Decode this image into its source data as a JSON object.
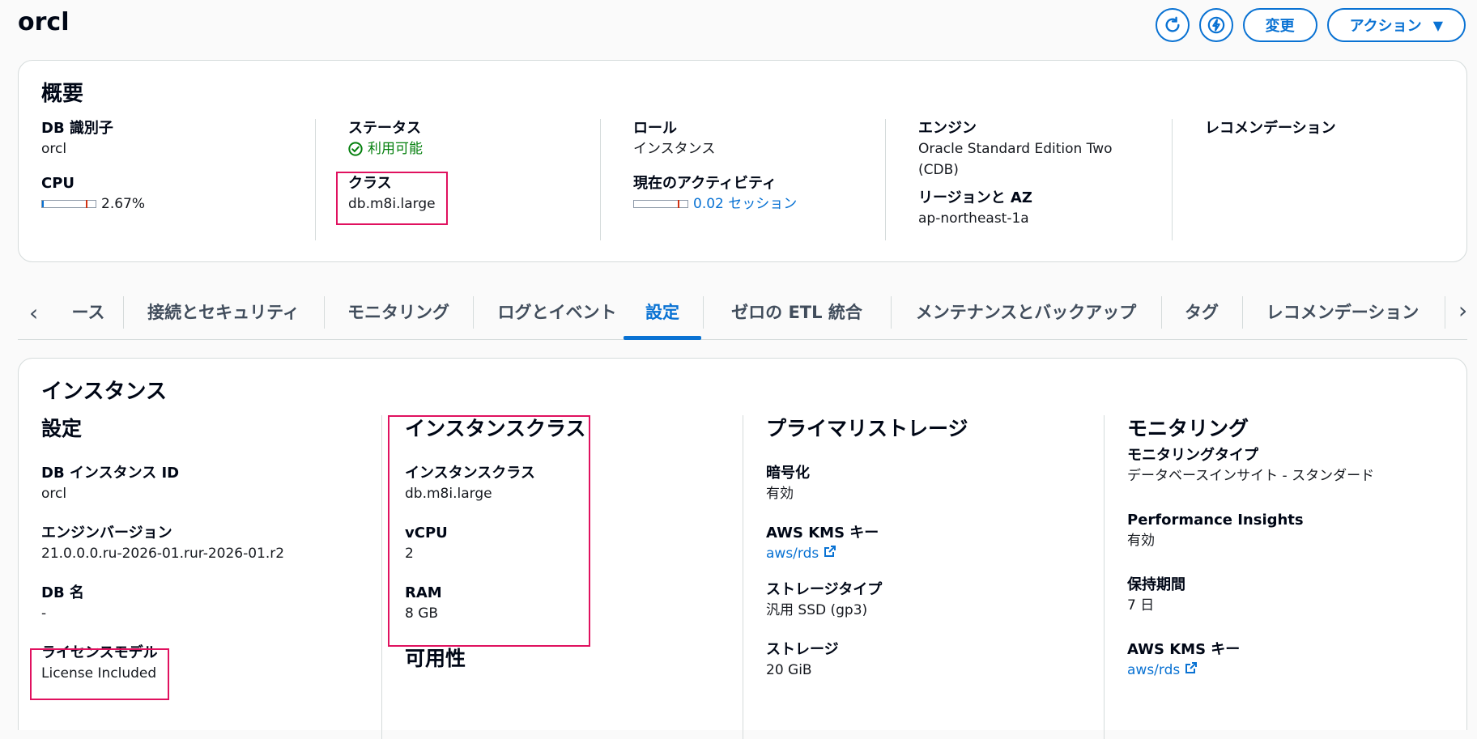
{
  "header": {
    "title": "orcl",
    "modify_label": "変更",
    "actions_label": "アクション"
  },
  "summary": {
    "title": "概要",
    "db_id_label": "DB 識別子",
    "db_id_value": "orcl",
    "cpu_label": "CPU",
    "cpu_value": "2.67%",
    "cpu_fraction": 0.0267,
    "status_label": "ステータス",
    "status_value": "利用可能",
    "class_label": "クラス",
    "class_value": "db.m8i.large",
    "role_label": "ロール",
    "role_value": "インスタンス",
    "activity_label": "現在のアクティビティ",
    "activity_value": "0.02 セッション",
    "engine_label": "エンジン",
    "engine_value_line1": "Oracle Standard Edition Two",
    "engine_value_line2": "(CDB)",
    "region_label": "リージョンと AZ",
    "region_value": "ap-northeast-1a",
    "recommendation_label": "レコメンデーション"
  },
  "tabs": [
    {
      "label": "ース"
    },
    {
      "label": "接続とセキュリティ"
    },
    {
      "label": "モニタリング"
    },
    {
      "label": "ログとイベント"
    },
    {
      "label": "設定"
    },
    {
      "label": "ゼロの ETL 統合"
    },
    {
      "label": "メンテナンスとバックアップ"
    },
    {
      "label": "タグ"
    },
    {
      "label": "レコメンデーション"
    }
  ],
  "instance": {
    "title": "インスタンス",
    "config": {
      "title": "設定",
      "instance_id_label": "DB インスタンス ID",
      "instance_id_value": "orcl",
      "engine_version_label": "エンジンバージョン",
      "engine_version_value": "21.0.0.0.ru-2026-01.rur-2026-01.r2",
      "db_name_label": "DB 名",
      "db_name_value": "-",
      "license_label": "ライセンスモデル",
      "license_value": "License Included"
    },
    "instance_class": {
      "title": "インスタンスクラス",
      "class_label": "インスタンスクラス",
      "class_value": "db.m8i.large",
      "vcpu_label": "vCPU",
      "vcpu_value": "2",
      "ram_label": "RAM",
      "ram_value": "8 GB",
      "availability_title": "可用性"
    },
    "storage": {
      "title": "プライマリストレージ",
      "encryption_label": "暗号化",
      "encryption_value": "有効",
      "kms_label": "AWS KMS キー",
      "kms_value": "aws/rds",
      "type_label": "ストレージタイプ",
      "type_value": "汎用 SSD (gp3)",
      "storage_label": "ストレージ",
      "storage_value": "20 GiB"
    },
    "monitoring": {
      "title": "モニタリング",
      "type_label": "モニタリングタイプ",
      "type_value": "データベースインサイト - スタンダード",
      "pi_label": "Performance Insights",
      "pi_value": "有効",
      "retention_label": "保持期間",
      "retention_value": "7 日",
      "kms_label": "AWS KMS キー",
      "kms_value": "aws/rds"
    }
  },
  "colors": {
    "accent": "#0972d3",
    "success": "#037f0c",
    "highlight": "#e0115f"
  }
}
